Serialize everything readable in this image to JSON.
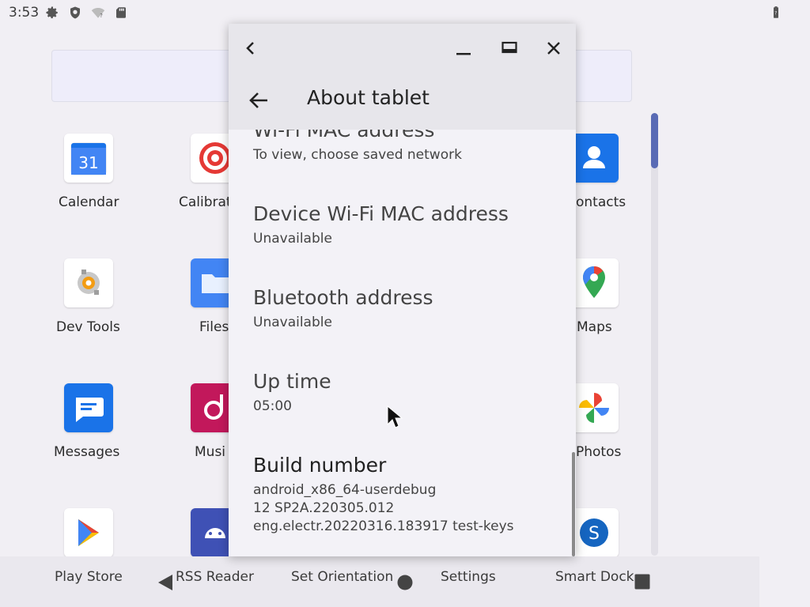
{
  "status_bar": {
    "time": "3:53",
    "icons": [
      "gear-icon",
      "shield-icon",
      "wifi-off-icon",
      "sd-card-icon",
      "battery-icon"
    ]
  },
  "launcher": {
    "apps": [
      {
        "label": "Calendar",
        "icon": "calendar-icon",
        "badge_text": "31"
      },
      {
        "label": "Calibrat",
        "icon": "calibrate-icon"
      },
      {
        "label": "ontacts",
        "icon": "contacts-icon"
      },
      {
        "label": "Dev Tools",
        "icon": "dev-tools-icon"
      },
      {
        "label": "Files",
        "icon": "files-icon"
      },
      {
        "label": "Maps",
        "icon": "maps-icon"
      },
      {
        "label": "Messages",
        "icon": "messages-icon"
      },
      {
        "label": "Musi",
        "icon": "music-icon"
      },
      {
        "label": "Photos",
        "icon": "photos-icon"
      },
      {
        "label": "",
        "icon": "play-store-icon"
      },
      {
        "label": "",
        "icon": "android-icon"
      },
      {
        "label": "",
        "icon": "skype-icon"
      }
    ]
  },
  "dock": {
    "items": [
      "Play Store",
      "RSS Reader",
      "Set Orientation",
      "Settings",
      "Smart Dock"
    ]
  },
  "window": {
    "header_title": "About tablet",
    "caption_buttons": [
      "back-icon",
      "minimize-icon",
      "maximize-icon",
      "close-icon"
    ],
    "prefs": [
      {
        "title": "Wi-Fi MAC address",
        "summary": "To view, choose saved network"
      },
      {
        "title": "Device Wi-Fi MAC address",
        "summary": "Unavailable"
      },
      {
        "title": "Bluetooth address",
        "summary": "Unavailable"
      },
      {
        "title": "Up time",
        "summary": "05:00"
      },
      {
        "title": "Build number",
        "summary_lines": [
          "android_x86_64-userdebug",
          "12 SP2A.220305.012",
          "eng.electr.20220316.183917 test-keys"
        ]
      }
    ]
  }
}
